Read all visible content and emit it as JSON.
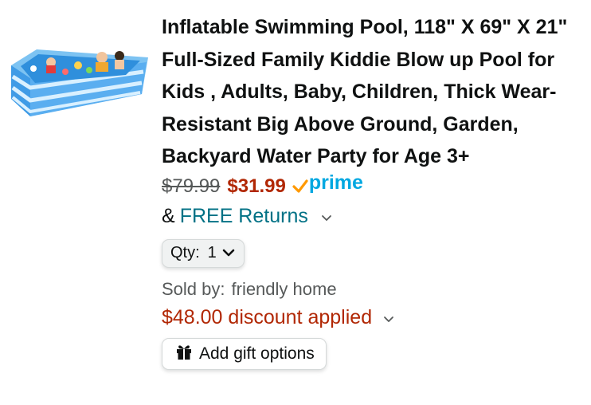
{
  "product": {
    "image_alt": "inflatable pool product image",
    "title": "Inflatable Swimming Pool, 118\" X 69\" X 21\" Full-Sized Family Kiddie Blow up Pool for Kids , Adults, Baby, Children, Thick Wear-Resistant Big Above Ground, Garden, Backyard Water Party for Age 3+",
    "list_price": "$79.99",
    "sale_price": "$31.99",
    "prime_label": "prime",
    "returns_prefix": "&",
    "returns_link": "FREE Returns",
    "qty_label": "Qty:",
    "qty_value": "1",
    "sold_by_label": "Sold by:",
    "seller": "friendly home",
    "discount_text": "$48.00 discount applied",
    "gift_label": "Add gift options"
  },
  "colors": {
    "title": "#0f1111",
    "sale_price": "#b12704",
    "list_price": "#565959",
    "link": "#007185",
    "prime_check": "#ff9900",
    "prime_text": "#00a8e1",
    "discount": "#b12704"
  },
  "icons": {
    "prime_check": "prime-check-icon",
    "returns_chevron": "chevron-down-icon",
    "qty_chevron": "chevron-down-icon",
    "discount_chevron": "chevron-down-icon",
    "gift": "gift-icon"
  }
}
